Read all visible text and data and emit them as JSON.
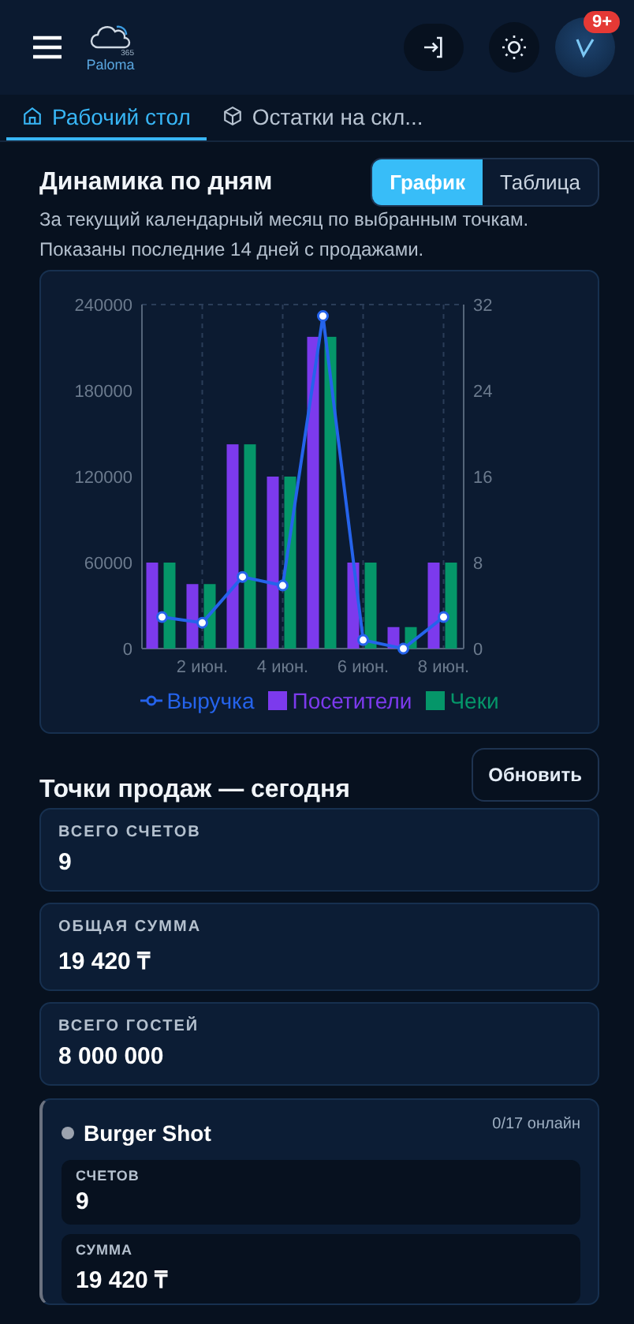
{
  "header": {
    "logo_text": "Paloma",
    "logo_sup": "365",
    "badge": "9+"
  },
  "tabs": [
    {
      "label": "Рабочий стол",
      "selected": true
    },
    {
      "label": "Остатки на скл...",
      "selected": false
    }
  ],
  "dynamics": {
    "title": "Динамика по дням",
    "view_toggle": [
      {
        "label": "График",
        "selected": true
      },
      {
        "label": "Таблица",
        "selected": false
      }
    ],
    "subtitle": "За текущий календарный месяц по выбранным точкам.",
    "note": "Показаны последние 14 дней с продажами.",
    "chart_data": {
      "type": "bar",
      "stacked": false,
      "grid": true,
      "x": [
        1,
        2,
        3,
        4,
        5,
        6,
        7,
        8
      ],
      "xlim": [
        0.5,
        8.5
      ],
      "series": [
        {
          "name": "Выручка",
          "type": "line",
          "marker": "circle",
          "color": "#2563eb",
          "values": [
            22000,
            18000,
            50000,
            44000,
            232000,
            6000,
            0,
            22000
          ]
        },
        {
          "name": "Посетители",
          "axis": "y2",
          "color": "#7c3aed",
          "values": [
            8,
            6,
            19,
            16,
            29,
            8,
            2,
            8
          ]
        },
        {
          "name": "Чеки",
          "axis": "y2",
          "color": "#059669",
          "values": [
            8,
            6,
            19,
            16,
            29,
            8,
            2,
            8
          ]
        }
      ],
      "ylim": [
        0,
        240000
      ],
      "yticks": [
        0,
        60000,
        120000,
        180000,
        240000
      ],
      "y2lim": [
        0,
        32
      ],
      "y2ticks": [
        0,
        8,
        16,
        24,
        32
      ],
      "xticks": [
        {
          "value": 2,
          "label": "2 июн."
        },
        {
          "value": 4,
          "label": "4 июн."
        },
        {
          "value": 6,
          "label": "6 июн."
        },
        {
          "value": 8,
          "label": "8 июн."
        }
      ]
    }
  },
  "points": {
    "title": "Точки продаж — сегодня",
    "refresh_button": "Обновить",
    "totals": [
      {
        "label": "ВСЕГО СЧЕТОВ",
        "value": "9"
      },
      {
        "label": "ОБЩАЯ СУММА",
        "value": "19 420 ₸"
      },
      {
        "label": "ВСЕГО ГОСТЕЙ",
        "value": "8 000 000"
      }
    ],
    "outlets": [
      {
        "name": "Burger Shot",
        "online": "0/17 онлайн",
        "metrics": [
          {
            "label": "СЧЕТОВ",
            "value": "9"
          },
          {
            "label": "СУММА",
            "value": "19 420 ₸"
          }
        ]
      }
    ]
  }
}
